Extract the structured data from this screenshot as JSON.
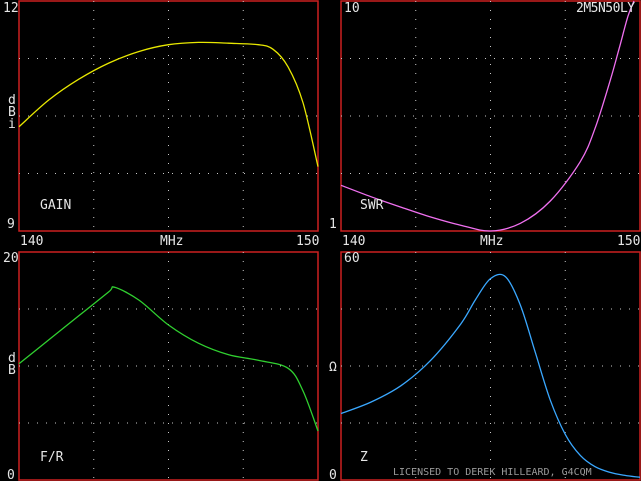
{
  "callsign": "2M5N50LY",
  "footer": "LICENSED TO DEREK HILLEARD, G4CQM",
  "colors": {
    "frame": "#cc2020",
    "grid": "#c8c8c8",
    "text": "#e6e6e6",
    "gain": "#e8e800",
    "swr": "#f070f0",
    "fr": "#30d030",
    "z": "#3aa8ff"
  },
  "chart_data": [
    {
      "type": "line",
      "label": "GAIN",
      "ylabel": "dBi",
      "xlabel": "MHz",
      "xlim": [
        140,
        150
      ],
      "ylim": [
        9,
        12
      ],
      "x_ticks": [
        "140",
        "MHz",
        "150"
      ],
      "y_ticks": [
        "12",
        "9"
      ],
      "grid": true,
      "series": [
        {
          "color": "#e8e800",
          "x": [
            140,
            141,
            142,
            143,
            144,
            145,
            146,
            147,
            148,
            148.5,
            149,
            149.5,
            150
          ],
          "y": [
            10.36,
            10.71,
            10.98,
            11.19,
            11.34,
            11.43,
            11.46,
            11.45,
            11.43,
            11.37,
            11.14,
            10.67,
            9.84
          ]
        }
      ]
    },
    {
      "type": "line",
      "label": "SWR",
      "xlabel": "MHz",
      "xlim": [
        140,
        150
      ],
      "ylim": [
        1,
        10
      ],
      "yscale": "log",
      "x_ticks": [
        "140",
        "MHz",
        "150"
      ],
      "y_ticks": [
        "10",
        "1"
      ],
      "grid": true,
      "series": [
        {
          "color": "#f070f0",
          "x": [
            140,
            141,
            142,
            143,
            144,
            145,
            146,
            147,
            148,
            148.5,
            149,
            149.3,
            149.6,
            149.8
          ],
          "y": [
            1.58,
            1.41,
            1.27,
            1.15,
            1.06,
            1.0,
            1.08,
            1.35,
            2.0,
            2.8,
            4.5,
            6.2,
            8.6,
            10
          ]
        }
      ]
    },
    {
      "type": "line",
      "label": "F/R",
      "ylabel": "dB",
      "xlim": [
        140,
        150
      ],
      "ylim": [
        0,
        20
      ],
      "y_ticks": [
        "20",
        "0"
      ],
      "grid": true,
      "series": [
        {
          "color": "#30d030",
          "x": [
            140,
            141,
            142,
            143,
            143.2,
            144,
            145,
            146,
            147,
            148,
            149,
            149.5,
            150
          ],
          "y": [
            10.2,
            12.3,
            14.4,
            16.5,
            16.9,
            15.8,
            13.6,
            12.0,
            11.0,
            10.5,
            9.8,
            7.8,
            4.3
          ]
        }
      ]
    },
    {
      "type": "line",
      "label": "Z",
      "ylabel": "Ω",
      "xlim": [
        140,
        150
      ],
      "ylim": [
        0,
        60
      ],
      "y_ticks": [
        "60",
        "0"
      ],
      "grid": true,
      "series": [
        {
          "color": "#3aa8ff",
          "x": [
            140,
            141,
            142,
            143,
            144,
            144.5,
            145,
            145.5,
            146,
            146.5,
            147,
            147.5,
            148,
            148.5,
            149,
            149.5,
            150
          ],
          "y": [
            17.5,
            20.5,
            24.8,
            31.5,
            41.0,
            47.5,
            53.0,
            53.5,
            46.0,
            33.5,
            21.0,
            12.0,
            6.5,
            3.5,
            2.0,
            1.2,
            0.7
          ]
        }
      ]
    }
  ]
}
